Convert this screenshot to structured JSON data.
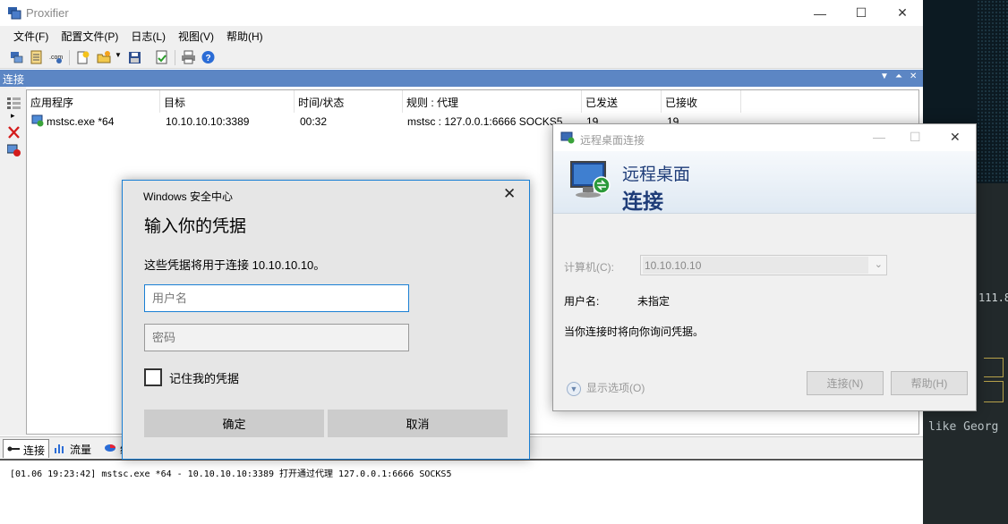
{
  "app": {
    "title": "Proxifier"
  },
  "menu": [
    "文件(F)",
    "配置文件(P)",
    "日志(L)",
    "视图(V)",
    "帮助(H)"
  ],
  "panel": {
    "title": "连接"
  },
  "table": {
    "columns": [
      "应用程序",
      "目标",
      "时间/状态",
      "规则 : 代理",
      "已发送",
      "已接收"
    ],
    "rows": [
      {
        "app": "mstsc.exe *64",
        "target": "10.10.10.10:3389",
        "time": "00:32",
        "rule": "mstsc : 127.0.0.1:6666 SOCKS5",
        "sent": "19",
        "received": "19"
      }
    ]
  },
  "tabs": [
    "连接",
    "流量",
    "统"
  ],
  "log": {
    "line": "[01.06 19:23:42] mstsc.exe *64 - 10.10.10.10:3389 打开通过代理 127.0.0.1:6666 SOCKS5"
  },
  "security_dialog": {
    "caption": "Windows 安全中心",
    "heading": "输入你的凭据",
    "description": "这些凭据将用于连接 10.10.10.10。",
    "username_placeholder": "用户名",
    "password_placeholder": "密码",
    "remember_label": "记住我的凭据",
    "ok_label": "确定",
    "cancel_label": "取消"
  },
  "rdp_window": {
    "title": "远程桌面连接",
    "banner_line1": "远程桌面",
    "banner_line2": "连接",
    "computer_label": "计算机(C):",
    "computer_value": "10.10.10.10",
    "username_label": "用户名:",
    "username_value": "未指定",
    "info": "当你连接时将向你询问凭据。",
    "show_options": "显示选项(O)",
    "connect_label": "连接(N)",
    "help_label": "帮助(H)"
  },
  "terminal": {
    "text1": "111.8",
    "text2": "like Georg"
  }
}
